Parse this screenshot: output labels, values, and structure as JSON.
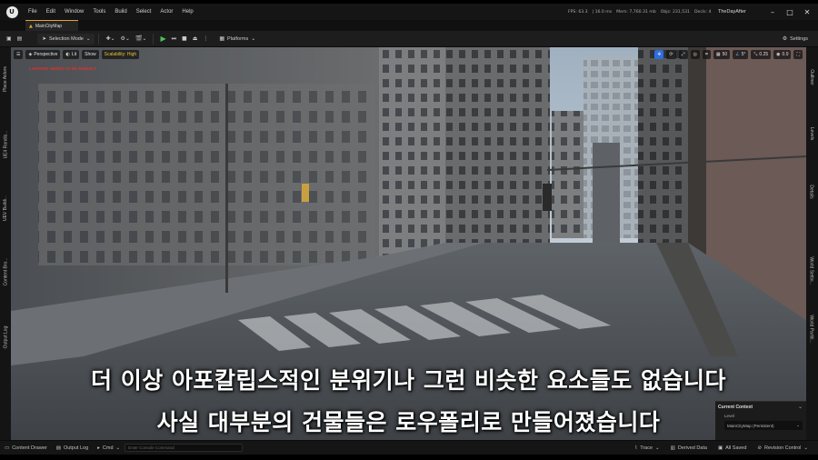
{
  "menubar": {
    "items": [
      "File",
      "Edit",
      "Window",
      "Tools",
      "Build",
      "Select",
      "Actor",
      "Help"
    ],
    "stats": [
      "FPS: 63.3",
      "| 16.0 ms",
      "Mem: 7,760.31 mb",
      "Objs: 231,531",
      "Decls: 4"
    ],
    "project_name": "TheDayAfter"
  },
  "tabs": {
    "map_tab": "MainCityMap"
  },
  "toolbar": {
    "selection_mode": "Selection Mode",
    "platforms": "Platforms",
    "settings": "Settings"
  },
  "viewport": {
    "perspective": "Perspective",
    "lit": "Lit",
    "show": "Show",
    "scalability": "Scalability: High",
    "warning": "LIGHTING NEEDS TO BE REBUILT",
    "grid_snap": "50",
    "rotation_snap": "5°",
    "scale_snap": "0.25",
    "camera_speed": "0.9"
  },
  "left_panel_tabs": [
    "Place Actors",
    "UE4 Randis...",
    "UEV Buildi...",
    "Content Bro...",
    "Output Log"
  ],
  "right_panel_tabs": [
    "Outliner",
    "Levels",
    "Details",
    "World Settin...",
    "World Partiti..."
  ],
  "subtitles": {
    "line1": "더 이상 아포칼립스적인 분위기나 그런 비슷한 요소들도 없습니다",
    "line2": "사실 대부분의 건물들은 로우폴리로 만들어졌습니다"
  },
  "context_panel": {
    "title": "Current Context",
    "level_label": "Level",
    "level_value": "MainCityMap (Persistent)"
  },
  "statusbar": {
    "content_drawer": "Content Drawer",
    "output_log": "Output Log",
    "cmd": "Cmd",
    "cmd_placeholder": "Enter Console Command",
    "trace": "Trace",
    "derived_data": "Derived Data",
    "all_saved": "All Saved",
    "revision_control": "Revision Control"
  },
  "colors": {
    "accent": "#e6a03b",
    "play_green": "#4fbf5a",
    "warning_red": "#e03030",
    "scalability_yellow": "#e8c030"
  }
}
